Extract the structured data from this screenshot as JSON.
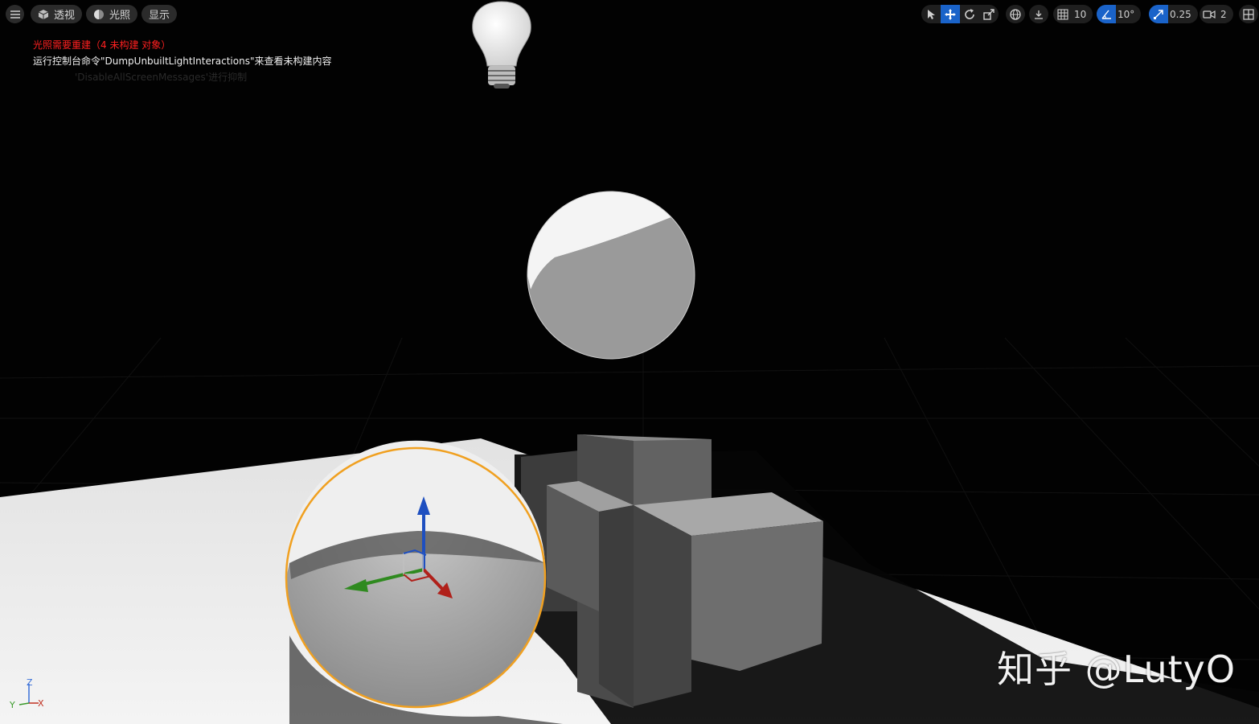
{
  "toolbar": {
    "menu_icon": "hamburger-menu-icon",
    "perspective_label": "透视",
    "lighting_label": "光照",
    "show_label": "显示",
    "grid_snap_value": "10",
    "rotation_snap_value": "10°",
    "scale_snap_value": "0.25",
    "camera_speed_value": "2"
  },
  "messages": {
    "warning": "光照需要重建（4 未构建 对象）",
    "command": "运行控制台命令\"DumpUnbuiltLightInteractions\"来查看未构建内容",
    "disable_hint": "'DisableAllScreenMessages'进行抑制"
  },
  "axis_widget": {
    "z": "Z",
    "y": "Y",
    "x": "X"
  },
  "watermark": "知乎 @LutyO",
  "colors": {
    "accent": "#1a63c9",
    "selection": "#f0a020",
    "warning": "#ff2020",
    "gizmo_z": "#1e4fc0",
    "gizmo_y": "#2f8a1f",
    "gizmo_x": "#b0201a"
  }
}
